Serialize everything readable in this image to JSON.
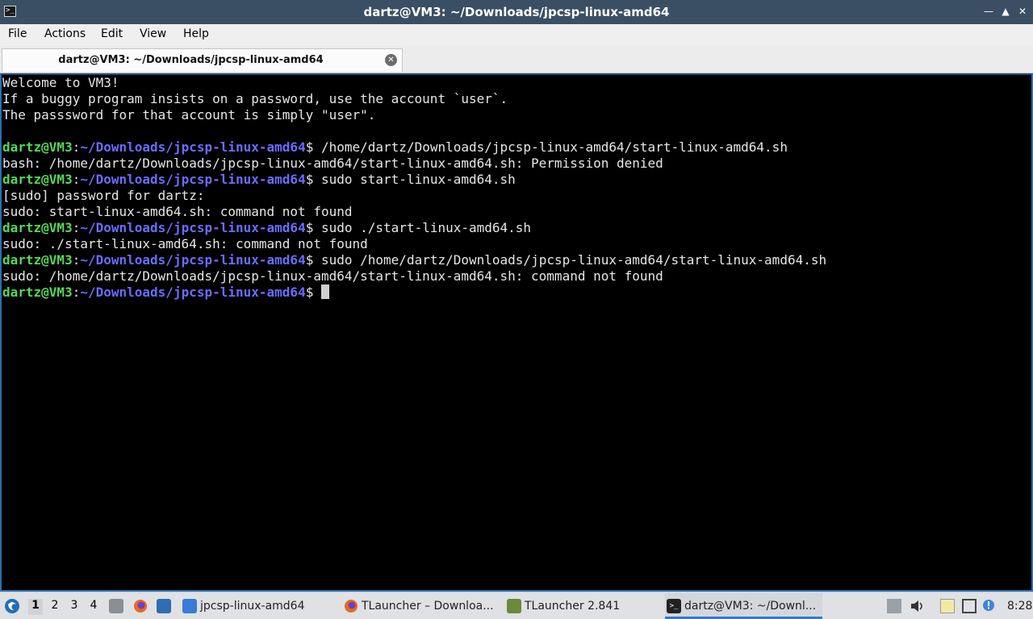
{
  "window": {
    "title": "dartz@VM3: ~/Downloads/jpcsp-linux-amd64",
    "app_icon": "terminal-icon",
    "controls": [
      "minimize",
      "maximize",
      "close"
    ]
  },
  "menu": [
    "File",
    "Actions",
    "Edit",
    "View",
    "Help"
  ],
  "tab": {
    "label": "dartz@VM3: ~/Downloads/jpcsp-linux-amd64",
    "close_icon": "close-icon"
  },
  "terminal": {
    "lines": [
      {
        "text": "Welcome to VM3!"
      },
      {
        "text": "If a buggy program insists on a password, use the account `user`."
      },
      {
        "text": "The passsword for that account is simply \"user\"."
      },
      {
        "text": ""
      },
      {
        "user": "dartz@VM3",
        "sep": ":",
        "path": "~/Downloads/jpcsp-linux-amd64",
        "dollar": "$",
        "cmd": " /home/dartz/Downloads/jpcsp-linux-amd64/start-linux-amd64.sh"
      },
      {
        "text": "bash: /home/dartz/Downloads/jpcsp-linux-amd64/start-linux-amd64.sh: Permission denied"
      },
      {
        "user": "dartz@VM3",
        "sep": ":",
        "path": "~/Downloads/jpcsp-linux-amd64",
        "dollar": "$",
        "cmd": " sudo start-linux-amd64.sh"
      },
      {
        "text": "[sudo] password for dartz:"
      },
      {
        "text": "sudo: start-linux-amd64.sh: command not found"
      },
      {
        "user": "dartz@VM3",
        "sep": ":",
        "path": "~/Downloads/jpcsp-linux-amd64",
        "dollar": "$",
        "cmd": " sudo ./start-linux-amd64.sh"
      },
      {
        "text": "sudo: ./start-linux-amd64.sh: command not found"
      },
      {
        "user": "dartz@VM3",
        "sep": ":",
        "path": "~/Downloads/jpcsp-linux-amd64",
        "dollar": "$",
        "cmd": " sudo /home/dartz/Downloads/jpcsp-linux-amd64/start-linux-amd64.sh"
      },
      {
        "text": "sudo: /home/dartz/Downloads/jpcsp-linux-amd64/start-linux-amd64.sh: command not found"
      },
      {
        "user": "dartz@VM3",
        "sep": ":",
        "path": "~/Downloads/jpcsp-linux-amd64",
        "dollar": "$",
        "cmd": " ",
        "cursor": true
      }
    ],
    "colors": {
      "user": "#56d65a",
      "path": "#6a6cff",
      "text": "#e6e6e6",
      "background": "#000000"
    }
  },
  "taskbar": {
    "start_icon": "start-menu-icon",
    "workspaces": [
      "1",
      "2",
      "3",
      "4"
    ],
    "active_workspace": "1",
    "launchers": [
      "file-manager-icon",
      "firefox-icon",
      "desktop-icon"
    ],
    "tasks": [
      {
        "label": "jpcsp-linux-amd64",
        "icon": "folder-icon"
      },
      {
        "label": "TLauncher – Downloa...",
        "icon": "firefox-icon"
      },
      {
        "label": "TLauncher 2.841",
        "icon": "minecraft-icon"
      },
      {
        "label": "dartz@VM3: ~/Downl...",
        "icon": "terminal-icon"
      }
    ],
    "active_task": 3,
    "tray_icons": [
      "updates-icon",
      "volume-icon",
      "clipboard-icon",
      "network-icon",
      "notification-icon"
    ],
    "clock": "8:28"
  }
}
